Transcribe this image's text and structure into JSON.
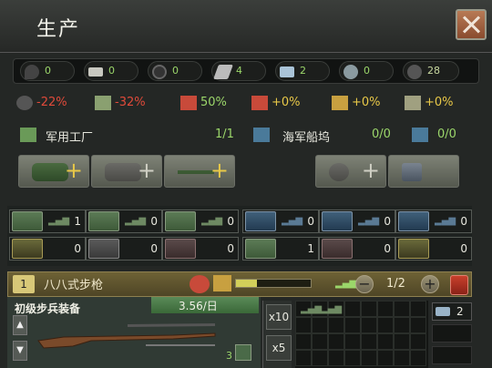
{
  "window": {
    "title": "生产"
  },
  "resources": [
    {
      "icon": "oil-icon",
      "value": "0"
    },
    {
      "icon": "aluminium-icon",
      "value": "0"
    },
    {
      "icon": "rubber-icon",
      "value": "0"
    },
    {
      "icon": "tungsten-icon",
      "value": "4"
    },
    {
      "icon": "steel-icon",
      "value": "2"
    },
    {
      "icon": "chromium-icon",
      "value": "0"
    },
    {
      "icon": "fuel-gauge-icon",
      "value": "28"
    }
  ],
  "modifiers": [
    {
      "icon": "fuel-modifier-icon",
      "value": "-22%",
      "color": "#e04a3a"
    },
    {
      "icon": "consumer-goods-icon",
      "value": "-32%",
      "color": "#e04a3a"
    },
    {
      "icon": "factory-output-icon",
      "value": "50%",
      "color": "#9bd66a"
    },
    {
      "icon": "dockyard-output-icon",
      "value": "+0%",
      "color": "#e8c848"
    },
    {
      "icon": "efficiency-cap-icon",
      "value": "+0%",
      "color": "#e8c848"
    },
    {
      "icon": "production-cost-icon",
      "value": "+0%",
      "color": "#e8c848"
    }
  ],
  "military": {
    "label": "军用工厂",
    "count": "1/1"
  },
  "naval": {
    "label": "海军船坞",
    "count": "0/0",
    "repair_count": "0/0"
  },
  "equipment": {
    "row1": [
      "1",
      "0",
      "0",
      "0",
      "0",
      "0"
    ],
    "row2": [
      "0",
      "0",
      "0",
      "1",
      "0",
      "0"
    ]
  },
  "production_line": {
    "index": "1",
    "name": "八八式步枪",
    "progress": 0.28,
    "minus": "−",
    "plus": "+",
    "count": "1/2",
    "equipment_name": "初级步兵装备",
    "efficiency": "3.56/日",
    "factories": "3",
    "mult_x10": "x10",
    "mult_x5": "x5",
    "resource_need": "2"
  }
}
